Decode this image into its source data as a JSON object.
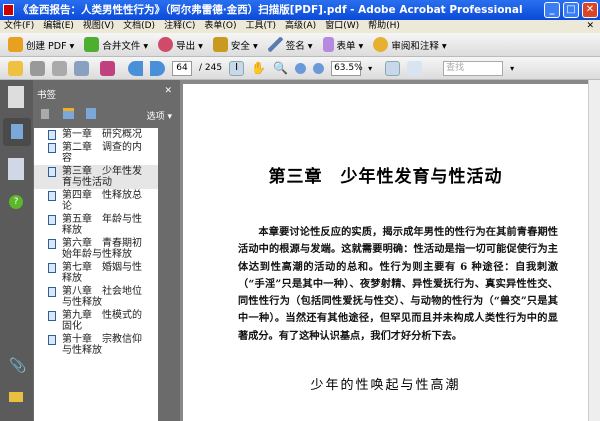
{
  "window": {
    "title": "《金西报告：人类男性性行为》（阿尔弗雷德·金西）扫描版[PDF].pdf - Adobe Acrobat Professional"
  },
  "menu": [
    "文件(F)",
    "编辑(E)",
    "视图(V)",
    "文档(D)",
    "注释(C)",
    "表单(O)",
    "工具(T)",
    "高级(A)",
    "窗口(W)",
    "帮助(H)"
  ],
  "toolbar1": [
    {
      "label": "创建 PDF ▾",
      "color": "#e8a020"
    },
    {
      "label": "合并文件 ▾",
      "color": "#4caf30"
    },
    {
      "label": "导出 ▾",
      "color": "#d04a6a"
    },
    {
      "label": "安全 ▾",
      "color": "#c89a20"
    },
    {
      "label": "签名 ▾",
      "color": "#5a7ab0"
    },
    {
      "label": "表单 ▾",
      "color": "#8a5ac0"
    },
    {
      "label": "审阅和注释 ▾",
      "color": "#e8b030"
    }
  ],
  "toolbar2": {
    "page_current": "64",
    "page_total": "/ 245",
    "zoom": "63.5%",
    "find_placeholder": "查找"
  },
  "bookmarks": {
    "title": "书签",
    "options": "选项 ▾",
    "items": [
      "第一章　研究概况",
      "第二章　调查的内容",
      "第三章　少年性发育与性活动",
      "第四章　性释放总论",
      "第五章　年龄与性释放",
      "第六章　青春期初始年龄与性释放",
      "第七章　婚姻与性释放",
      "第八章　社会地位与性释放",
      "第九章　性模式的固化",
      "第十章　宗教信仰与性释放"
    ],
    "selected_index": 2
  },
  "document": {
    "chapter_title": "第三章　少年性发育与性活动",
    "paragraph": "本章要讨论性反应的实质，揭示成年男性的性行为在其前青春期性活动中的根源与发端。这就需要明确：性活动是指一切可能促使行为主体达到性高潮的活动的总和。性行为则主要有 6 种途径：自我刺激（“手淫”只是其中一种）、夜梦射精、异性爱抚行为、真实异性性交、同性性行为（包括同性爱抚与性交）、与动物的性行为（“兽交”只是其中一种）。当然还有其他途径，但罕见而且并未构成人类性行为中的显著成分。有了这种认识基点，我们才好分析下去。",
    "subheading": "少年的性唤起与性高潮"
  }
}
